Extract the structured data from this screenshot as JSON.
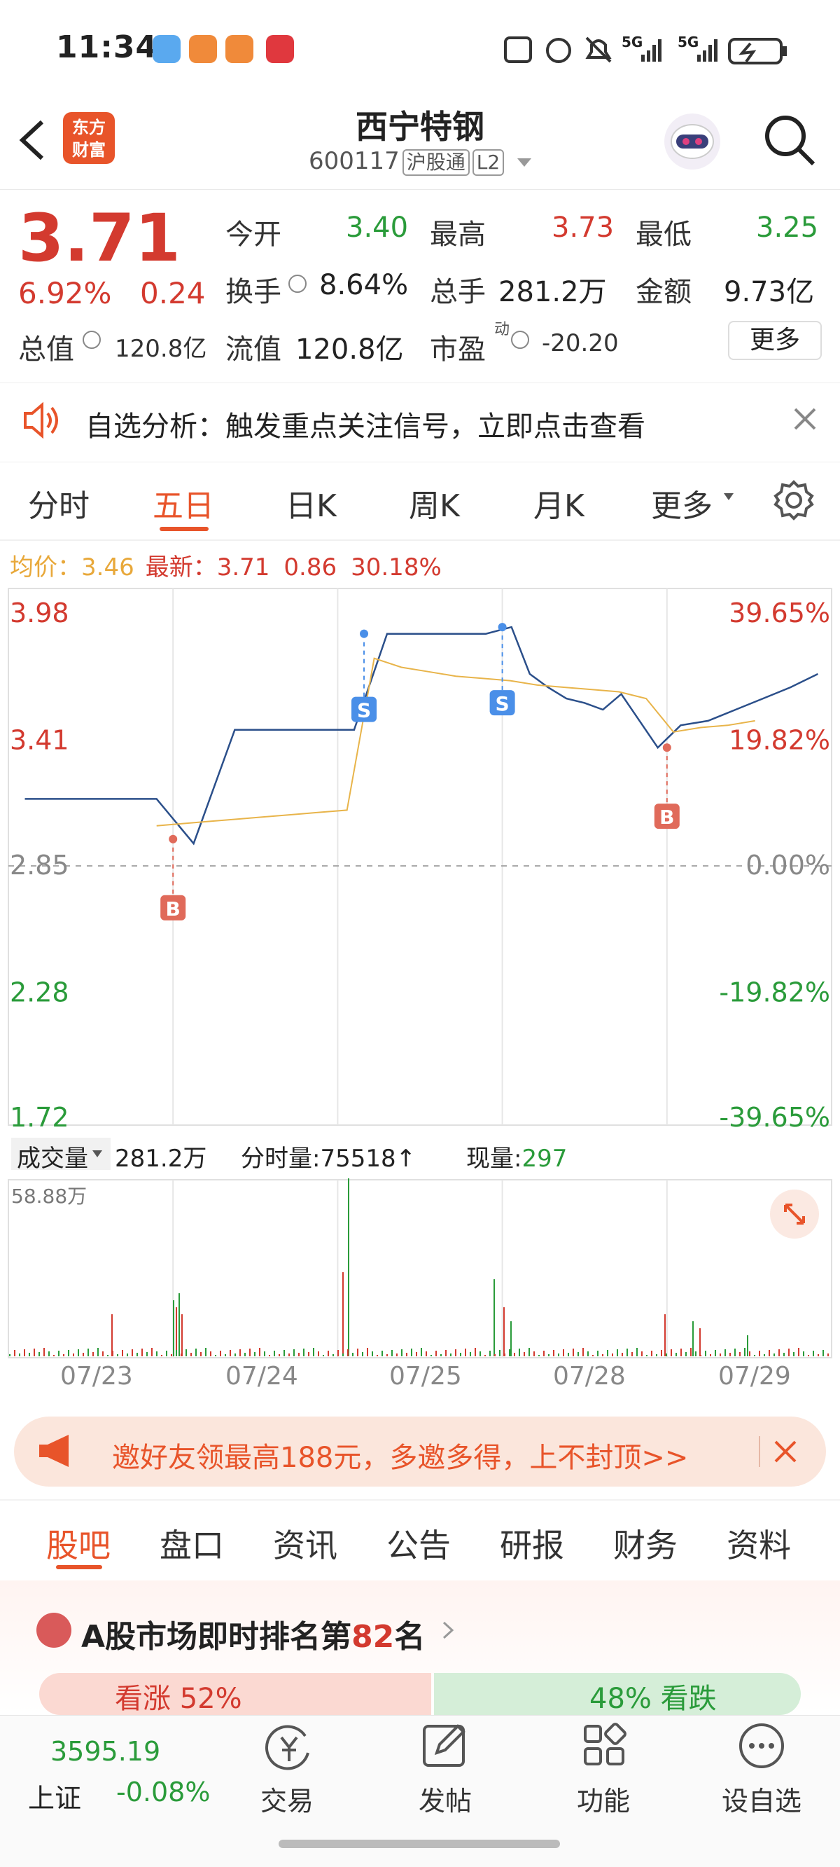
{
  "status": {
    "time": "11:34",
    "signal_label_1": "5G",
    "signal_label_2": "5G"
  },
  "header": {
    "brand_logo": "东方\n财富",
    "stock_name": "西宁特钢",
    "stock_code": "600117",
    "tag1": "沪股通",
    "tag2": "L2"
  },
  "quote": {
    "price": "3.71",
    "change_pct": "6.92%",
    "change": "0.24",
    "open_label": "今开",
    "open": "3.40",
    "high_label": "最高",
    "high": "3.73",
    "low_label": "最低",
    "low": "3.25",
    "turnover_label": "换手",
    "turnover": "8.64%",
    "volume_label": "总手",
    "volume": "281.2万",
    "amount_label": "金额",
    "amount": "9.73亿",
    "mktcap_label": "总值",
    "mktcap": "120.8亿",
    "float_label": "流值",
    "float_cap": "120.8亿",
    "pe_label": "市盈",
    "pe_sup": "动",
    "pe": "-20.20",
    "more_button": "更多"
  },
  "notice": {
    "text": "自选分析：触发重点关注信号，立即点击查看"
  },
  "chart_tabs": [
    "分时",
    "五日",
    "日K",
    "周K",
    "月K",
    "更多"
  ],
  "chart_info": {
    "avg_label": "均价：",
    "avg": "3.46",
    "latest_label": "最新：",
    "latest": "3.71",
    "change": "0.86",
    "change_pct": "30.18%"
  },
  "chart_data": {
    "type": "line",
    "title": "",
    "y_ticks_left": [
      "3.98",
      "3.41",
      "2.85",
      "2.28",
      "1.72"
    ],
    "y_ticks_right": [
      "39.65%",
      "19.82%",
      "0.00%",
      "-19.82%",
      "-39.65%"
    ],
    "ylim": [
      1.72,
      3.98
    ],
    "x_ticks": [
      "07/23",
      "07/24",
      "07/25",
      "07/28",
      "07/29"
    ],
    "series": [
      {
        "values": [
          3.15,
          3.15,
          3.15,
          3.15,
          3.15,
          2.95,
          3.46,
          3.46,
          3.46,
          3.46,
          3.89,
          3.89,
          3.89,
          3.89,
          3.92,
          3.71,
          3.65,
          3.6,
          3.58,
          3.55,
          3.62,
          3.5,
          3.38,
          3.48,
          3.5,
          3.55,
          3.6,
          3.65,
          3.71
        ]
      },
      {
        "values": [
          3.03,
          3.04,
          3.05,
          3.06,
          3.07,
          3.08,
          3.09,
          3.1,
          3.78,
          3.74,
          3.72,
          3.7,
          3.69,
          3.68,
          3.66,
          3.65,
          3.64,
          3.63,
          3.6,
          3.45,
          3.47,
          3.48,
          3.5
        ]
      }
    ],
    "markers": [
      {
        "label": "B",
        "x": "07/23",
        "value": 2.97
      },
      {
        "label": "S",
        "x": "07/24",
        "value": 3.89
      },
      {
        "label": "S",
        "x": "07/25",
        "value": 3.92
      },
      {
        "label": "B",
        "x": "07/28",
        "value": 3.38
      }
    ]
  },
  "volume_info": {
    "label": "成交量",
    "total": "281.2万",
    "tick_label": "分时量:75518↑",
    "now_label": "现量:",
    "now": "297",
    "max": "58.88万"
  },
  "banner": {
    "text": "邀好友领最高188元，多邀多得，上不封顶>>"
  },
  "bottom_tabs": [
    "股吧",
    "盘口",
    "资讯",
    "公告",
    "研报",
    "财务",
    "资料"
  ],
  "ranking": {
    "prefix": "A股市场即时排名第",
    "rank": "82",
    "suffix": "名",
    "up": "看涨 52%",
    "down": "48% 看跌"
  },
  "nav": {
    "index_value": "3595.19",
    "index_name": "上证",
    "index_change": "-0.08%",
    "trade": "交易",
    "post": "发帖",
    "func": "功能",
    "watch": "设自选"
  }
}
